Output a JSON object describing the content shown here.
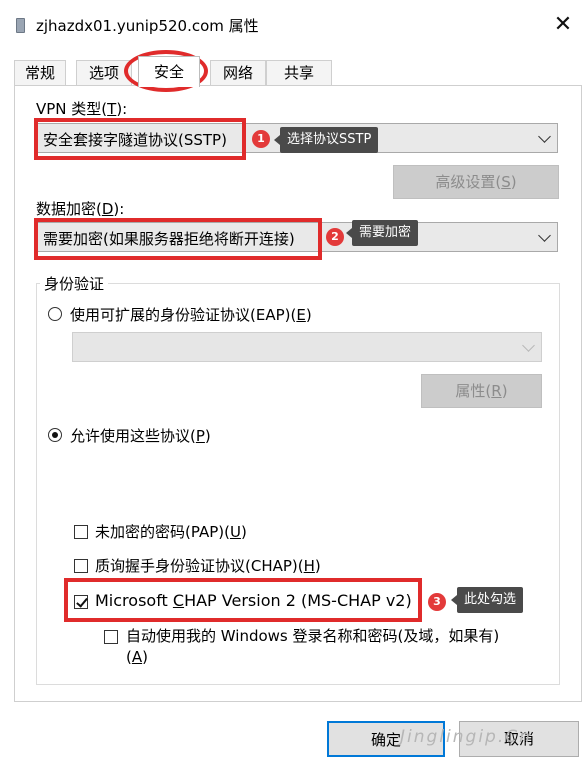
{
  "window": {
    "title": "zjhazdx01.yunip520.com 属性",
    "close_glyph": "✕"
  },
  "tabs": [
    {
      "label": "常规"
    },
    {
      "label": "选项"
    },
    {
      "label": "安全"
    },
    {
      "label": "网络"
    },
    {
      "label": "共享"
    }
  ],
  "vpn": {
    "label_prefix": "VPN 类型(",
    "label_key": "T",
    "label_suffix": "):",
    "value": "安全套接字隧道协议(SSTP)",
    "advanced_prefix": "高级设置(",
    "advanced_key": "S",
    "advanced_suffix": ")"
  },
  "encryption": {
    "label_prefix": "数据加密(",
    "label_key": "D",
    "label_suffix": "):",
    "value": "需要加密(如果服务器拒绝将断开连接)"
  },
  "auth": {
    "group_title": "身份验证",
    "eap_prefix": "使用可扩展的身份验证协议(EAP)(",
    "eap_key": "E",
    "eap_suffix": ")",
    "eap_selected": false,
    "properties_prefix": "属性(",
    "properties_key": "R",
    "properties_suffix": ")",
    "allow_prefix": "允许使用这些协议(",
    "allow_key": "P",
    "allow_suffix": ")",
    "allow_selected": true,
    "protocols": [
      {
        "prefix": "未加密的密码(PAP)(",
        "key": "U",
        "suffix": ")",
        "checked": false
      },
      {
        "prefix": "质询握手身份验证协议(CHAP)(",
        "key": "H",
        "suffix": ")",
        "checked": false
      },
      {
        "prefix": "Microsoft ",
        "key": "C",
        "suffix": "HAP Version 2 (MS-CHAP v2)",
        "checked": true
      }
    ],
    "autologon_line1": "自动使用我的 Windows 登录名称和密码(及域，如果有)",
    "autologon_prefix2": "(",
    "autologon_key": "A",
    "autologon_suffix2": ")",
    "autologon_checked": false
  },
  "footer": {
    "ok_label": "确定",
    "cancel_label": "取消"
  },
  "annotations": [
    {
      "number": "1",
      "text": "选择协议SSTP"
    },
    {
      "number": "2",
      "text": "需要加密"
    },
    {
      "number": "3",
      "text": "此处勾选"
    }
  ],
  "watermark": "Jinglingip.Cn",
  "colors": {
    "annotation_red": "#e02b2b",
    "tooltip_bg": "#4a4a4a",
    "disabled_button": "#cccccc"
  }
}
